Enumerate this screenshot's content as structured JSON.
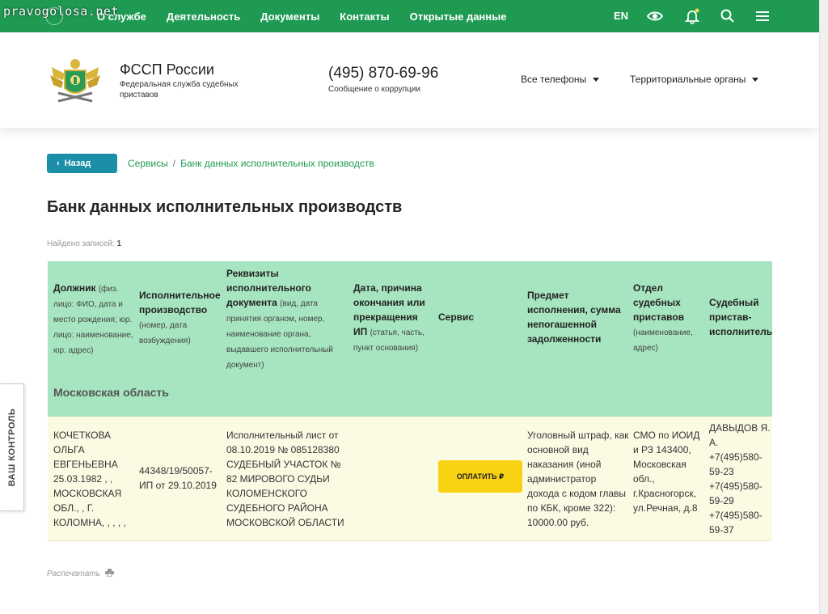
{
  "watermark": "pravogolosa.net",
  "topnav": {
    "items": [
      "О службе",
      "Деятельность",
      "Документы",
      "Контакты",
      "Открытые данные"
    ],
    "lang": "EN",
    "icons": [
      "eye-icon",
      "bell-icon",
      "search-icon",
      "menu-icon"
    ]
  },
  "header": {
    "title": "ФССП России",
    "subtitle": "Федеральная служба судебных приставов",
    "phone": "(495) 870-69-96",
    "phone_sub": "Сообщение о коррупции",
    "dropdown_phones": "Все телефоны",
    "dropdown_regions": "Территориальные органы"
  },
  "breadcrumb": {
    "back": "Назад",
    "items": [
      "Сервисы",
      "Банк данных исполнительных производств"
    ],
    "separator": "/"
  },
  "page_title": "Банк данных исполнительных производств",
  "found": {
    "label": "Найдено записей:",
    "count": "1"
  },
  "table": {
    "headers": [
      {
        "title": "Должник",
        "note": "(физ. лицо: ФИО, дата и место рождения; юр. лицо: наименование, юр. адрес)"
      },
      {
        "title": "Исполнительное производство",
        "note": "(номер, дата возбуждения)"
      },
      {
        "title": "Реквизиты исполнительного документа",
        "note": "(вид, дата принятия органом, номер, наименование органа, выдавшего исполнительный документ)"
      },
      {
        "title": "Дата, причина окончания или прекращения ИП",
        "note": "(статья, часть, пункт основания)"
      },
      {
        "title": "Сервис",
        "note": ""
      },
      {
        "title": "Предмет исполнения, сумма непогашенной задолженности",
        "note": ""
      },
      {
        "title": "Отдел судебных приставов",
        "note": "(наименование, адрес)"
      },
      {
        "title": "Судебный пристав-исполнитель",
        "note": ""
      }
    ],
    "region": "Московская область",
    "row": {
      "debtor": "КОЧЕТКОВА ОЛЬГА ЕВГЕНЬЕВНА 25.03.1982 , , МОСКОВСКАЯ ОБЛ., , Г. КОЛОМНА, , , , ,",
      "proceeding": "44348/19/50057-ИП от 29.10.2019",
      "document": "Исполнительный лист от 08.10.2019 № 085128380 СУДЕБНЫЙ УЧАСТОК № 82 МИРОВОГО СУДЬИ КОЛОМЕНСКОГО СУДЕБНОГО РАЙОНА МОСКОВСКОЙ ОБЛАСТИ",
      "end_reason": "",
      "pay_button": "ОПЛАТИТЬ ₽",
      "subject": "Уголовный штраф, как основной вид наказания (иной администратор дохода с кодом главы по КБК, кроме 322): 10000.00 руб.",
      "department": "СМО по ИОИД и РЗ 143400, Московская обл., г.Красногорск, ул.Речная, д.8",
      "bailiff": "ДАВЫДОВ Я. А. +7(495)580-59-23 +7(495)580-59-29 +7(495)580-59-37"
    }
  },
  "print_label": "Распечатать",
  "side_tab": "ВАШ КОНТРОЛЬ",
  "colors": {
    "green": "#1e9a52",
    "table_header": "#a6e5bf",
    "row": "#fbfbe4",
    "pay": "#f8d212",
    "back": "#1b8fa8"
  }
}
